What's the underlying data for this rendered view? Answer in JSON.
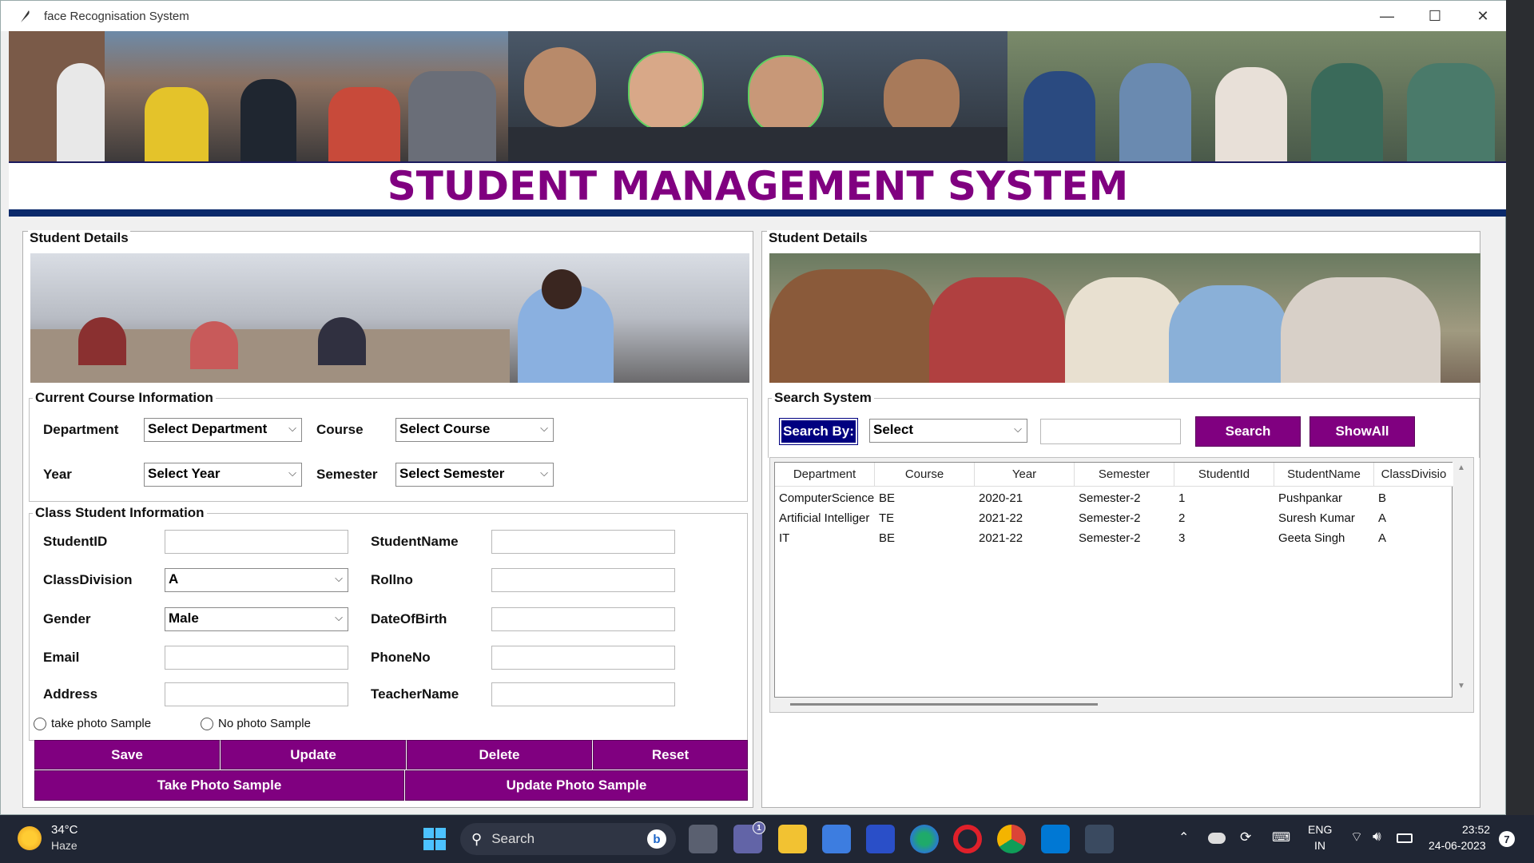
{
  "window": {
    "title": "face Recognisation System",
    "controls": [
      "—",
      "☐",
      "✕"
    ]
  },
  "heading": "STUDENT MANAGEMENT SYSTEM",
  "left_panel": {
    "label": "Student Details",
    "course_group": {
      "label": "Current Course Information",
      "department_label": "Department",
      "department_value": "Select Department",
      "course_label": "Course",
      "course_value": "Select Course",
      "year_label": "Year",
      "year_value": "Select Year",
      "semester_label": "Semester",
      "semester_value": "Select Semester"
    },
    "class_group": {
      "label": "Class Student Information",
      "studentid_label": "StudentID",
      "studentname_label": "StudentName",
      "classdivision_label": "ClassDivision",
      "classdivision_value": "A",
      "rollno_label": "Rollno",
      "gender_label": "Gender",
      "gender_value": "Male",
      "dob_label": "DateOfBirth",
      "email_label": "Email",
      "phone_label": "PhoneNo",
      "address_label": "Address",
      "teacher_label": "TeacherName",
      "radio1": "take photo Sample",
      "radio2": "No photo Sample"
    },
    "buttons": {
      "save": "Save",
      "update": "Update",
      "delete": "Delete",
      "reset": "Reset",
      "take_photo": "Take Photo Sample",
      "update_photo": "Update Photo Sample"
    }
  },
  "right_panel": {
    "label": "Student Details",
    "search": {
      "label": "Search System",
      "search_by": "Search By:",
      "select_value": "Select",
      "search_button": "Search",
      "showall_button": "ShowAll"
    },
    "table": {
      "columns": [
        "Department",
        "Course",
        "Year",
        "Semester",
        "StudentId",
        "StudentName",
        "ClassDivisio"
      ],
      "rows": [
        [
          "ComputerScience",
          "BE",
          "2020-21",
          "Semester-2",
          "1",
          "Pushpankar",
          "B"
        ],
        [
          "Artificial Intelliger",
          "TE",
          "2021-22",
          "Semester-2",
          "2",
          "Suresh Kumar",
          "A"
        ],
        [
          "IT",
          "BE",
          "2021-22",
          "Semester-2",
          "3",
          "Geeta Singh",
          "A"
        ]
      ]
    }
  },
  "taskbar": {
    "weather_temp": "34°C",
    "weather_desc": "Haze",
    "search": "Search",
    "teams_badge": "1",
    "lang1": "ENG",
    "lang2": "IN",
    "time": "23:52",
    "date": "24-06-2023",
    "notif": "7"
  }
}
